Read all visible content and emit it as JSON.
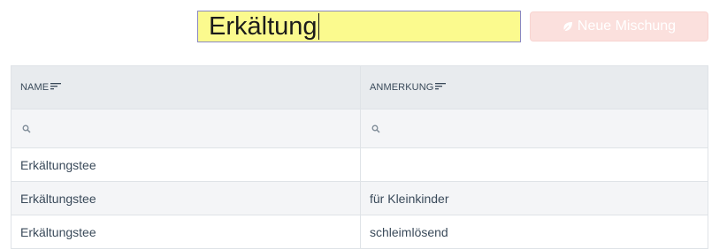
{
  "search": {
    "value": "Erkältung"
  },
  "toolbar": {
    "new_mix_label": "Neue Mischung",
    "new_mix_icon": "leaf-icon"
  },
  "table": {
    "columns": [
      {
        "label": "NAME",
        "sort_icon": "sort-icon"
      },
      {
        "label": "ANMERKUNG",
        "sort_icon": "sort-icon"
      }
    ],
    "filter_icon": "search-icon",
    "rows": [
      {
        "name": "Erkältungstee",
        "note": ""
      },
      {
        "name": "Erkältungstee",
        "note": "für Kleinkinder"
      },
      {
        "name": "Erkältungstee",
        "note": "schleimlösend"
      }
    ]
  },
  "colors": {
    "input_bg": "#fbfa8e",
    "button_bg": "#fbe0dd",
    "header_bg": "#e8ebee",
    "stripe_bg": "#f4f5f7",
    "text": "#3a4a5a"
  }
}
